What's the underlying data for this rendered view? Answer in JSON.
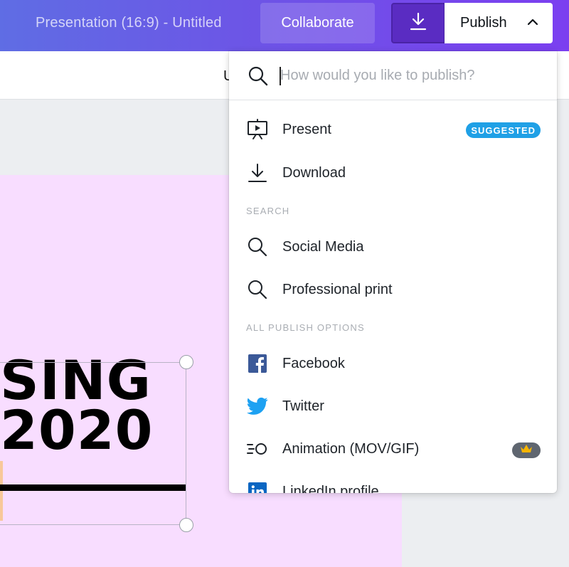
{
  "header": {
    "doc_title": "Presentation (16:9) - Untitled",
    "collaborate_label": "Collaborate",
    "download_icon": "download-icon",
    "publish_label": "Publish",
    "publish_chevron": "chevron-up-icon"
  },
  "toolbar": {
    "partial_label": "U"
  },
  "slide": {
    "line1": "SING",
    "line2": "2020",
    "background_color": "#f8ddff"
  },
  "publish_menu": {
    "search_placeholder": "How would you like to publish?",
    "search_value": "",
    "top_items": [
      {
        "label": "Present",
        "icon": "present-icon",
        "badge": "SUGGESTED"
      },
      {
        "label": "Download",
        "icon": "download-icon"
      }
    ],
    "search_header": "SEARCH",
    "search_items": [
      {
        "label": "Social Media",
        "icon": "search-icon"
      },
      {
        "label": "Professional print",
        "icon": "search-icon"
      }
    ],
    "all_header": "ALL PUBLISH OPTIONS",
    "all_items": [
      {
        "label": "Facebook",
        "icon": "facebook-icon"
      },
      {
        "label": "Twitter",
        "icon": "twitter-icon"
      },
      {
        "label": "Animation (MOV/GIF)",
        "icon": "animation-icon",
        "badge_icon": "crown-icon"
      },
      {
        "label": "LinkedIn profile",
        "icon": "linkedin-icon"
      }
    ]
  },
  "colors": {
    "topbar_start": "#5f6de4",
    "topbar_end": "#7b3ff0",
    "suggested_badge": "#1fa0e6",
    "facebook_blue": "#3b5998",
    "twitter_blue": "#1da1f2",
    "linkedin_blue": "#0a66c2",
    "crown_gold": "#f6b400"
  }
}
